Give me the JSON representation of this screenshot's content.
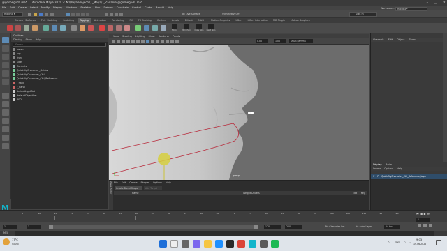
{
  "title_bar": {
    "text": "Autodesk Maya 2020.2: N:\\Maya Projects\\1_Maya\\1_Zadanie\\@gosheguda.ma*",
    "prefix": "@gosheguda.ma*"
  },
  "menu": [
    "File",
    "Edit",
    "Create",
    "Select",
    "Modify",
    "Display",
    "Windows",
    "Skeleton",
    "Skin",
    "Deform",
    "Constrain",
    "Control",
    "Cache",
    "Arnold",
    "Help"
  ],
  "status_line": {
    "mode": "Rigging",
    "no_live_surface": "No Live Surface",
    "symmetry": "Symmetry: Off",
    "sign_in": "Sign In",
    "workspace_label": "Workspace:",
    "workspace_value": "Rigging*"
  },
  "shelf_tabs": [
    "Curves / Surfaces",
    "Poly Modeling",
    "Sculpting",
    "Rigging",
    "Animation",
    "Rendering",
    "FX",
    "FX Caching",
    "Custom",
    "Arnold",
    "Bifrost",
    "MASH",
    "Motion Graphics",
    "XGen",
    "XGen Interactive",
    "MD Plugin",
    "Motion Graphics"
  ],
  "active_shelf_tab": "Rigging",
  "shelf_right_labels": [
    "Mirror",
    "MirrorSkin",
    "Copy Skin",
    "Paint Skin"
  ],
  "outliner": {
    "title": "Outliner",
    "menu": [
      "Display",
      "Show",
      "Help"
    ],
    "search_placeholder": "Search...",
    "items": [
      {
        "label": "persp",
        "color": "#888"
      },
      {
        "label": "top",
        "color": "#888"
      },
      {
        "label": "front",
        "color": "#888"
      },
      {
        "label": "side",
        "color": "#888"
      },
      {
        "label": "Controls",
        "color": "#9aa"
      },
      {
        "label": "QuickRigCharacter_Guides",
        "color": "#7c9"
      },
      {
        "label": "QuickRigCharacter_Ctrl",
        "color": "#7c9"
      },
      {
        "label": "QuickRigCharacter_Ctrl_Reference",
        "color": "#7c9"
      },
      {
        "label": "l_hand",
        "color": "#c66"
      },
      {
        "label": "r_hand",
        "color": "#c66"
      },
      {
        "label": "defaultLightSet",
        "color": "#ccc"
      },
      {
        "label": "defaultObjectSet",
        "color": "#ccc"
      },
      {
        "label": "PSD",
        "color": "#ccc"
      }
    ]
  },
  "viewport": {
    "menu": [
      "View",
      "Shading",
      "Lighting",
      "Show",
      "Renderer",
      "Panels"
    ],
    "field_1": "0.00",
    "field_2": "1.00",
    "color_space": "sRGB gamma",
    "camera_label": "persp"
  },
  "channel_box": {
    "menu": [
      "Channels",
      "Edit",
      "Object",
      "Show"
    ]
  },
  "display_layers": {
    "tabs": [
      "Display",
      "Anim"
    ],
    "menu": [
      "Layers",
      "Options",
      "Help"
    ],
    "layer_v": "V",
    "layer_p": "P",
    "layer_name": "QuickRigCharacter_Ctrl_Reference_layer"
  },
  "shape_editor": {
    "menu": [
      "File",
      "Edit",
      "Create",
      "Shapes",
      "Options",
      "Help"
    ],
    "create_button": "Create Blend Shape",
    "add_target_button": "Add Target",
    "columns": [
      "Name",
      "Weight/Drivers",
      "Edit",
      "Key"
    ],
    "side_label": "Shape Editor"
  },
  "time_slider": {
    "ticks": [
      "5",
      "10",
      "15",
      "20",
      "25",
      "30",
      "35",
      "40",
      "45",
      "50",
      "55",
      "60",
      "65",
      "70",
      "75",
      "80",
      "85",
      "90",
      "95",
      "100",
      "105",
      "110",
      "115",
      "120"
    ],
    "current_frame": "1",
    "start": "1",
    "end": "120",
    "range_start": "1",
    "range_end": "120",
    "playback_end": "200",
    "anim_end": "200",
    "char_set": "No Character Set",
    "anim_layer": "No Anim Layer",
    "fps": "24 fps"
  },
  "command_line": {
    "label": "MEL"
  },
  "taskbar": {
    "weather_temp": "17°C",
    "weather_desc": "Rosso",
    "search_placeholder": "Search",
    "lang": "ENG",
    "time": "9:03",
    "date": "19.06.2022"
  },
  "colors": {
    "accent_blue": "#5d8bb5",
    "active_tab": "#5d5d5d",
    "viewport_bg": "#6c6c6c",
    "deformer_curve": "#b8293a",
    "joint_yellow": "#d6cf3e"
  }
}
